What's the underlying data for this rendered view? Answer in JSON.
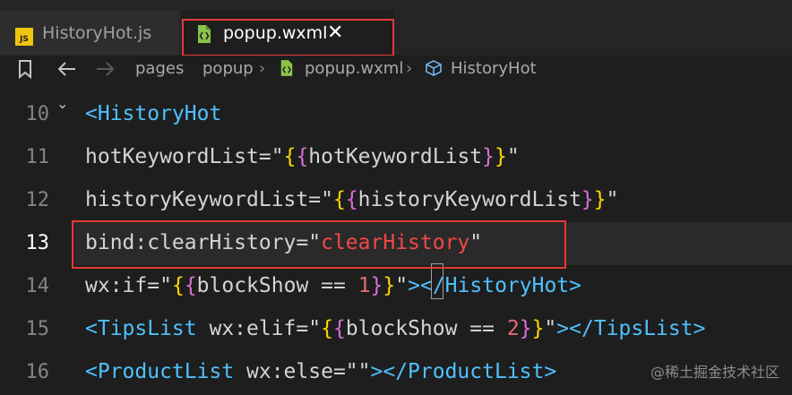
{
  "tabs": [
    {
      "label": "HistoryHot.js",
      "icon": "js-file-icon",
      "active": false
    },
    {
      "label": "popup.wxml",
      "icon": "wxml-file-icon",
      "active": true
    }
  ],
  "tab_close_symbol": "✕",
  "breadcrumb": {
    "parts": [
      "pages",
      "popup",
      "popup.wxml",
      "HistoryHot"
    ],
    "separator": "›"
  },
  "editor": {
    "lines": [
      {
        "number": "10",
        "tokens": [
          {
            "t": "<",
            "c": "c-tag"
          },
          {
            "t": "HistoryHot",
            "c": "c-tag"
          }
        ]
      },
      {
        "number": "11",
        "tokens": [
          {
            "t": "hotKeywordList",
            "c": "c-attr"
          },
          {
            "t": "=\"",
            "c": "c-attr"
          },
          {
            "t": "{",
            "c": "c-br1"
          },
          {
            "t": "{",
            "c": "c-br2"
          },
          {
            "t": "hotKeywordList",
            "c": "c-attr"
          },
          {
            "t": "}",
            "c": "c-br2"
          },
          {
            "t": "}",
            "c": "c-br1"
          },
          {
            "t": "\"",
            "c": "c-attr"
          }
        ]
      },
      {
        "number": "12",
        "tokens": [
          {
            "t": "historyKeywordList",
            "c": "c-attr"
          },
          {
            "t": "=\"",
            "c": "c-attr"
          },
          {
            "t": "{",
            "c": "c-br1"
          },
          {
            "t": "{",
            "c": "c-br2"
          },
          {
            "t": "historyKeywordList",
            "c": "c-attr"
          },
          {
            "t": "}",
            "c": "c-br2"
          },
          {
            "t": "}",
            "c": "c-br1"
          },
          {
            "t": "\"",
            "c": "c-attr"
          }
        ]
      },
      {
        "number": "13",
        "tokens": [
          {
            "t": "bind:clearHistory",
            "c": "c-attr"
          },
          {
            "t": "=\"",
            "c": "c-attr"
          },
          {
            "t": "clearHistory",
            "c": "c-red"
          },
          {
            "t": "\"",
            "c": "c-attr"
          }
        ]
      },
      {
        "number": "14",
        "tokens": [
          {
            "t": "wx:if",
            "c": "c-attr"
          },
          {
            "t": "=\"",
            "c": "c-attr"
          },
          {
            "t": "{",
            "c": "c-br1"
          },
          {
            "t": "{",
            "c": "c-br2"
          },
          {
            "t": "blockShow == ",
            "c": "c-attr"
          },
          {
            "t": "1",
            "c": "c-num"
          },
          {
            "t": "}",
            "c": "c-br2"
          },
          {
            "t": "}",
            "c": "c-br1"
          },
          {
            "t": "\"",
            "c": "c-attr"
          },
          {
            "t": ">",
            "c": "c-tag"
          },
          {
            "t": "</HistoryHot>",
            "c": "c-tag"
          }
        ]
      },
      {
        "number": "15",
        "tokens": [
          {
            "t": "<TipsList",
            "c": "c-tag"
          },
          {
            "t": " wx:elif",
            "c": "c-attr"
          },
          {
            "t": "=\"",
            "c": "c-attr"
          },
          {
            "t": "{",
            "c": "c-br1"
          },
          {
            "t": "{",
            "c": "c-br2"
          },
          {
            "t": "blockShow == ",
            "c": "c-attr"
          },
          {
            "t": "2",
            "c": "c-num"
          },
          {
            "t": "}",
            "c": "c-br2"
          },
          {
            "t": "}",
            "c": "c-br1"
          },
          {
            "t": "\"",
            "c": "c-attr"
          },
          {
            "t": "></TipsList>",
            "c": "c-tag"
          }
        ]
      },
      {
        "number": "16",
        "tokens": [
          {
            "t": "<ProductList",
            "c": "c-tag"
          },
          {
            "t": " wx:else",
            "c": "c-attr"
          },
          {
            "t": "=\"\"",
            "c": "c-attr"
          },
          {
            "t": "></ProductList>",
            "c": "c-tag"
          }
        ]
      }
    ],
    "current_line": "13"
  },
  "watermark": "@稀土掘金技术社区",
  "colors": {
    "background": "#1e1e1e",
    "tag": "#4fc1ff",
    "highlight_box": "#e53935",
    "js_badge": "#f1c40f",
    "wxml_badge": "#8bc34a"
  }
}
